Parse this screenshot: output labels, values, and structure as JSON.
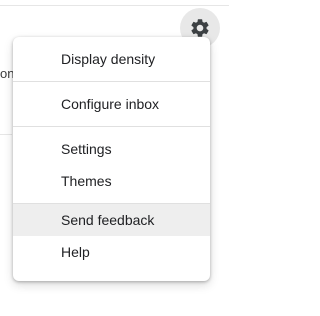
{
  "background": {
    "fragment_text": "on"
  },
  "gear_button": {
    "icon": "gear-icon",
    "background_color": "#e8e8e8"
  },
  "menu": {
    "items": [
      {
        "label": "Display density"
      },
      {
        "label": "Configure inbox"
      },
      {
        "label": "Settings"
      },
      {
        "label": "Themes"
      },
      {
        "label": "Send feedback",
        "highlighted": true
      },
      {
        "label": "Help"
      }
    ]
  },
  "colors": {
    "text": "#202124",
    "hover": "#eeeeee",
    "divider": "#e0e0e0"
  }
}
